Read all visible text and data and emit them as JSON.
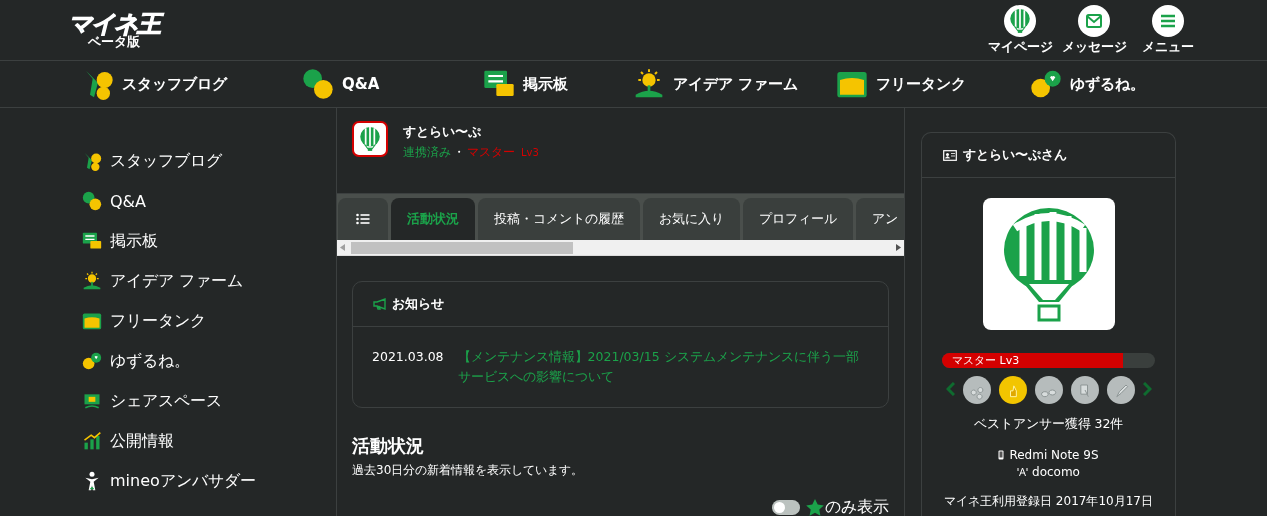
{
  "logo": {
    "title": "マイネ王",
    "subtitle": "ベータ版"
  },
  "header_actions": [
    {
      "label": "マイページ"
    },
    {
      "label": "メッセージ"
    },
    {
      "label": "メニュー"
    }
  ],
  "nav": [
    {
      "label": "スタッフブログ"
    },
    {
      "label": "Q&A"
    },
    {
      "label": "掲示板"
    },
    {
      "label": "アイデア ファーム"
    },
    {
      "label": "フリータンク"
    },
    {
      "label": "ゆずるね。"
    }
  ],
  "sidebar": {
    "items": [
      {
        "label": "スタッフブログ"
      },
      {
        "label": "Q&A"
      },
      {
        "label": "掲示板"
      },
      {
        "label": "アイデア ファーム"
      },
      {
        "label": "フリータンク"
      },
      {
        "label": "ゆずるね。"
      },
      {
        "label": "シェアスペース"
      },
      {
        "label": "公開情報"
      },
      {
        "label": "mineoアンバサダー"
      }
    ]
  },
  "profile": {
    "name": "すとらい〜ぷ",
    "status": "連携済み",
    "separator": "・",
    "rank": "マスター",
    "level": "Lv3"
  },
  "tabs": [
    {
      "kind": "icon",
      "selected": false
    },
    {
      "kind": "text",
      "label": "活動状況",
      "selected": true
    },
    {
      "kind": "text",
      "label": "投稿・コメントの履歴",
      "selected": false
    },
    {
      "kind": "text",
      "label": "お気に入り",
      "selected": false
    },
    {
      "kind": "text",
      "label": "プロフィール",
      "selected": false
    },
    {
      "kind": "text",
      "label": "アン",
      "selected": false
    }
  ],
  "notice": {
    "title": "お知らせ",
    "items": [
      {
        "date": "2021.03.08",
        "text": "【メンテナンス情報】2021/03/15 システムメンテナンスに伴う一部サービスへの影響について"
      }
    ]
  },
  "activity": {
    "title": "活動状況",
    "description": "過去30日分の新着情報を表示しています。",
    "filter": {
      "on": false,
      "label": "のみ表示"
    }
  },
  "user_card": {
    "title": "すとらい〜ぷさん",
    "rank_bar": {
      "label": "マスター Lv3",
      "level": 0.85
    },
    "badges": [
      {
        "selected": false
      },
      {
        "selected": true
      },
      {
        "selected": false
      },
      {
        "selected": false
      },
      {
        "selected": false
      }
    ],
    "badge_caption": "ベストアンサー獲得 32件",
    "device": "Redmi Note 9S",
    "carrier": "docomo",
    "registered": "マイネ王利用登録日 2017年10月17日"
  }
}
